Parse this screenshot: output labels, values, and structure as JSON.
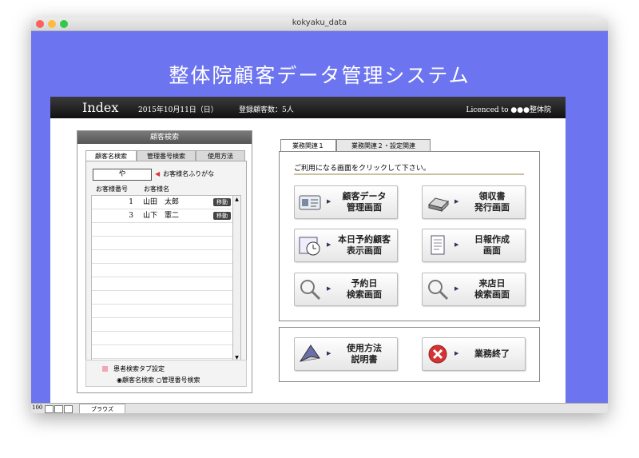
{
  "window": {
    "title": "kokyaku_data"
  },
  "app_title": "整体院顧客データ管理システム",
  "header": {
    "index": "Index",
    "date": "2015年10月11日（日）",
    "count": "登録顧客数：5人",
    "licence": "Licenced to ●●●整体院"
  },
  "left_panel": {
    "title": "顧客検索",
    "tabs": [
      "顧客名検索",
      "管理番号検索",
      "使用方法"
    ],
    "search_value": "や",
    "search_hint": "お客様名ふりがな",
    "col_number": "お客様番号",
    "col_name": "お客様名",
    "rows": [
      {
        "num": "1",
        "name": "山田　太郎",
        "move": "移動"
      },
      {
        "num": "3",
        "name": "山下　憲二",
        "move": "移動"
      }
    ],
    "option_title": "患者検索タブ設定",
    "option_choice": "◉顧客名検索 ○管理番号検索"
  },
  "right_panel": {
    "tabs": [
      "業務関連１",
      "業務関連２・設定関連"
    ],
    "message": "ご利用になる画面をクリックして下さい。",
    "buttons": {
      "customer": "顧客データ\n管理画面",
      "receipt": "領収書\n発行画面",
      "today": "本日予約顧客\n表示画面",
      "daily": "日報作成\n画面",
      "reserve": "予約日\n検索画面",
      "visit": "来店日\n検索画面",
      "manual": "使用方法\n説明書",
      "exit": "業務終了"
    }
  },
  "status": {
    "zoom": "100",
    "mode": "ブラウズ"
  },
  "colors": {
    "stage": "#6c74f0",
    "header": "#111111",
    "accent_red": "#d33333"
  }
}
